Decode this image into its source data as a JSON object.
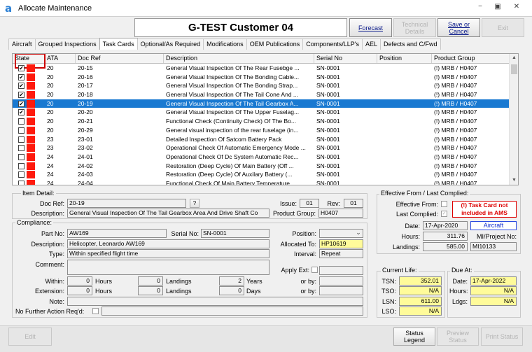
{
  "window": {
    "app_icon": "a",
    "title": "Allocate Maintenance",
    "controls": {
      "minimize": "−",
      "restore": "▣",
      "close": "✕"
    }
  },
  "header": {
    "title": "G-TEST Customer 04"
  },
  "toolbar": {
    "forecast": "Forecast",
    "technical_details": "Technical Details",
    "save_or_cancel": "Save or Cancel",
    "exit": "Exit"
  },
  "tabs": [
    "Aircraft",
    "Grouped Inspections",
    "Task Cards",
    "Optional/As Required",
    "Modifications",
    "OEM Publications",
    "Components/LLP's",
    "AEL",
    "Defects and C/Fwd"
  ],
  "active_tab": "Task Cards",
  "grid": {
    "columns": {
      "state": "State",
      "ata": "ATA",
      "doc_ref": "Doc Ref",
      "description": "Description",
      "serial_no": "Serial No",
      "position": "Position",
      "product_group": "Product Group"
    },
    "scroll_up": "▲",
    "scroll_down": "▼",
    "rows": [
      {
        "checked": "✔",
        "ata": "20",
        "doc_ref": "20-15",
        "description": "General Visual Inspection Of The Rear Fusebge ...",
        "serial_no": "SN-0001",
        "position": "",
        "product_group": "(!) MRB / H0407"
      },
      {
        "checked": "✔",
        "ata": "20",
        "doc_ref": "20-16",
        "description": "General Visual Inspection Of The Bonding Cable...",
        "serial_no": "SN-0001",
        "position": "",
        "product_group": "(!) MRB / H0407"
      },
      {
        "checked": "✔",
        "ata": "20",
        "doc_ref": "20-17",
        "description": "General Visual Inspection Of The Bonding Strap...",
        "serial_no": "SN-0001",
        "position": "",
        "product_group": "(!) MRB / H0407"
      },
      {
        "checked": "✔",
        "ata": "20",
        "doc_ref": "20-18",
        "description": "General Visual Inspection Of The Tail Cone And ...",
        "serial_no": "SN-0001",
        "position": "",
        "product_group": "(!) MRB / H0407"
      },
      {
        "checked": "✔",
        "ata": "20",
        "doc_ref": "20-19",
        "description": "General Visual Inspection Of The Tail Gearbox A...",
        "serial_no": "SN-0001",
        "position": "",
        "product_group": "(!) MRB / H0407"
      },
      {
        "checked": "✔",
        "ata": "20",
        "doc_ref": "20-20",
        "description": "General Visual Inspection Of The Upper Fuselag...",
        "serial_no": "SN-0001",
        "position": "",
        "product_group": "(!) MRB / H0407"
      },
      {
        "checked": "",
        "ata": "20",
        "doc_ref": "20-21",
        "description": "Functional Check (Continuity Check)  Of The Bo...",
        "serial_no": "SN-0001",
        "position": "",
        "product_group": "(!) MRB / H0407"
      },
      {
        "checked": "",
        "ata": "20",
        "doc_ref": "20-29",
        "description": "General visual inspection of the rear fuselage (in...",
        "serial_no": "SN-0001",
        "position": "",
        "product_group": "(!) MRB / H0407"
      },
      {
        "checked": "",
        "ata": "23",
        "doc_ref": "23-01",
        "description": "Detailed Inspection Of Satcom Battery Pack",
        "serial_no": "SN-0001",
        "position": "",
        "product_group": "(!) MRB / H0407"
      },
      {
        "checked": "",
        "ata": "23",
        "doc_ref": "23-02",
        "description": "Operational Check Of Automatic Emergency Mode ...",
        "serial_no": "SN-0001",
        "position": "",
        "product_group": "(!) MRB / H0407"
      },
      {
        "checked": "",
        "ata": "24",
        "doc_ref": "24-01",
        "description": "Operational Check Of Dc System Automatic Rec...",
        "serial_no": "SN-0001",
        "position": "",
        "product_group": "(!) MRB / H0407"
      },
      {
        "checked": "",
        "ata": "24",
        "doc_ref": "24-02",
        "description": "Restoration (Deep Cycle) Of Main Battery  (Off ...",
        "serial_no": "SN-0001",
        "position": "",
        "product_group": "(!) MRB / H0407"
      },
      {
        "checked": "",
        "ata": "24",
        "doc_ref": "24-03",
        "description": "Restoration (Deep Cycle) Of Auxilary Battery  (...",
        "serial_no": "SN-0001",
        "position": "",
        "product_group": "(!) MRB / H0407"
      },
      {
        "checked": "",
        "ata": "24",
        "doc_ref": "24-04",
        "description": "Functional Check Of Main Battery Temperature ...",
        "serial_no": "SN-0001",
        "position": "",
        "product_group": "(!) MRB / H0407"
      }
    ],
    "selected_row": 4
  },
  "item_detail": {
    "group_title": "Item Detail:",
    "doc_ref_label": "Doc Ref:",
    "doc_ref": "20-19",
    "lookup_button": "?",
    "issue_label": "Issue:",
    "issue": "01",
    "rev_label": "Rev:",
    "rev": "01",
    "description_label": "Description:",
    "description": "General Visual Inspection Of The Tail Gearbox Area And Drive Shaft Co",
    "product_group_label": "Product Group:",
    "product_group": "H0407"
  },
  "compliance": {
    "group_title": "Compliance:",
    "part_no_label": "Part No:",
    "part_no": "AW169",
    "serial_no_label": "Serial No:",
    "serial_no": "SN-0001",
    "position_label": "Position:",
    "position": "",
    "dropdown_arrow": "⌄",
    "description_label": "Description:",
    "description": "Helicopter, Leonardo AW169",
    "allocated_to_label": "Allocated To:",
    "allocated_to": "HP10619",
    "type_label": "Type:",
    "type": "Within specified flight time",
    "interval_label": "Interval:",
    "interval": "Repeat",
    "comment_label": "Comment:",
    "comment": "",
    "apply_ext_label": "Apply Ext:",
    "within_label": "Within:",
    "within_hours": "0",
    "within_landings": "0",
    "within_years": "2",
    "extension_label": "Extension:",
    "extension_hours": "0",
    "extension_landings": "0",
    "extension_days": "0",
    "hours_label": "Hours",
    "landings_label": "Landings",
    "years_label": "Years",
    "days_label": "Days",
    "or_by_label": "or by:",
    "note_label": "Note:",
    "no_further_action_label": "No Further Action Req'd:"
  },
  "effective": {
    "group_title": "Effective From / Last Complied:",
    "effective_from_label": "Effective From:",
    "last_complied_label": "Last Complied:",
    "checkmark": "✓",
    "warning": "(!) Task Card not included in AMS",
    "date_label": "Date:",
    "date": "17-Apr-2020",
    "aircraft": "Aircraft",
    "hours_label": "Hours:",
    "hours": "311.76",
    "mi_project_label": "MI/Project No:",
    "landings_label": "Landings:",
    "landings": "585.00",
    "mi_project": "MI10133"
  },
  "current_life": {
    "group_title": "Current Life:",
    "tsn_label": "TSN:",
    "tsn": "352.01",
    "tso_label": "TSO:",
    "tso": "N/A",
    "lsn_label": "LSN:",
    "lsn": "611.00",
    "lso_label": "LSO:",
    "lso": "N/A"
  },
  "due_at": {
    "group_title": "Due At:",
    "date_label": "Date:",
    "date": "17-Apr-2022",
    "hours_label": "Hours:",
    "hours": "N/A",
    "ldgs_label": "Ldgs:",
    "ldgs": "N/A"
  },
  "status_bar": {
    "edit": "Edit",
    "status_legend": "Status Legend",
    "preview_status": "Preview Status",
    "print_status": "Print Status"
  }
}
